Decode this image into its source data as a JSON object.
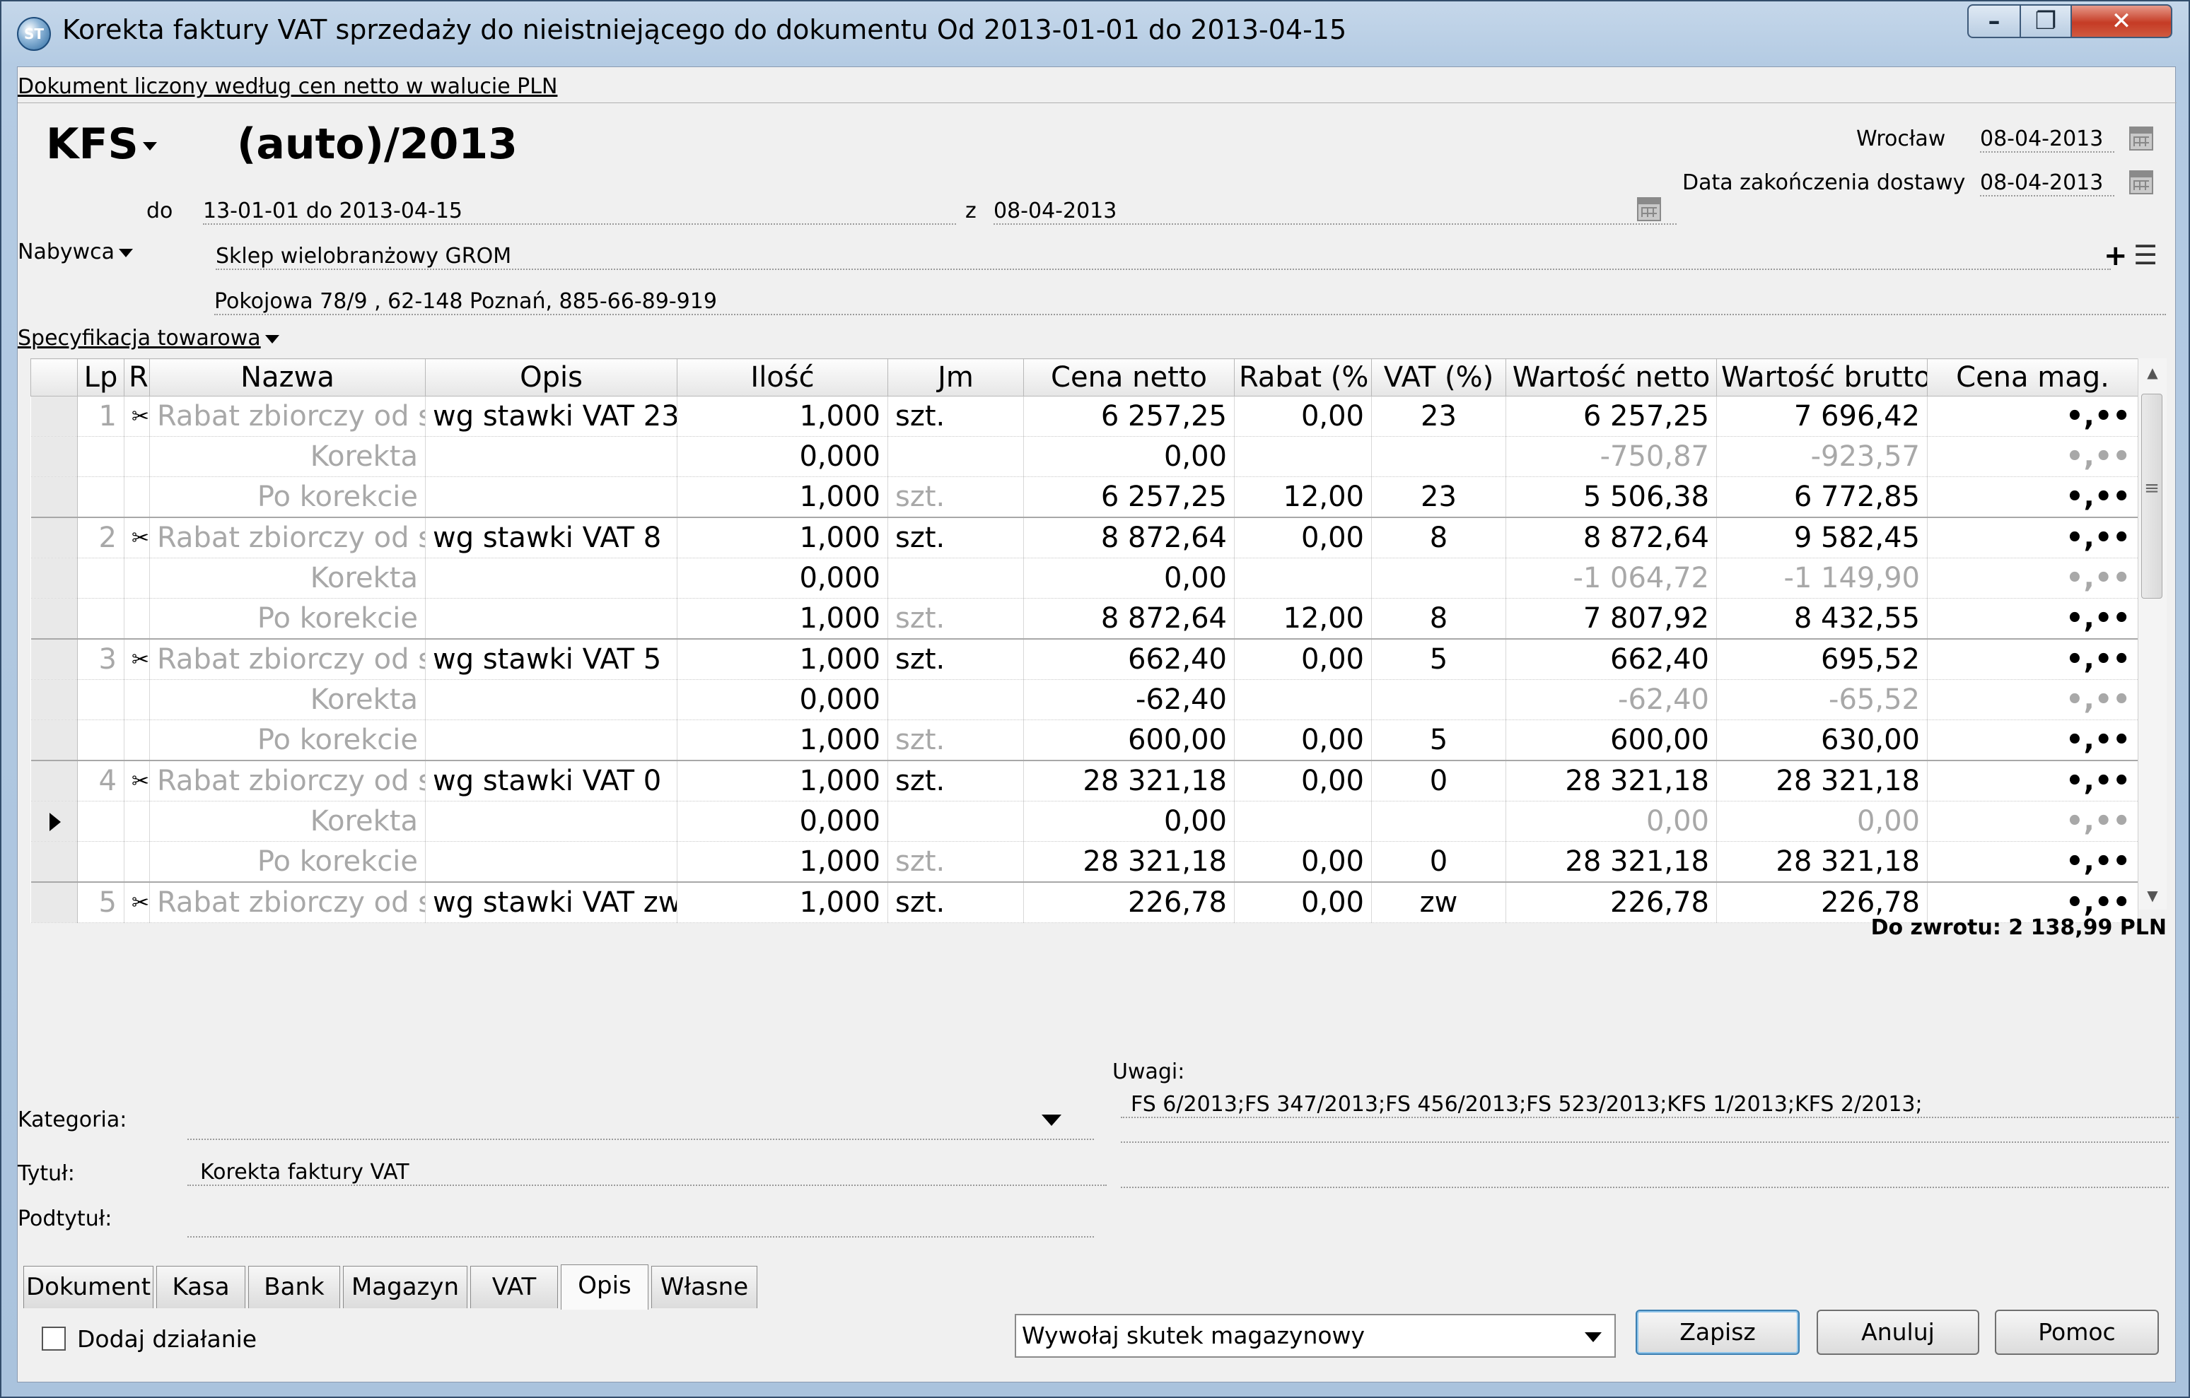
{
  "window": {
    "title": "Korekta faktury VAT sprzedaży do nieistniejącego do dokumentu Od 2013-01-01 do 2013-04-15",
    "icon": "app-logo-icon"
  },
  "doc_link": "Dokument liczony według cen netto w walucie PLN",
  "header": {
    "doc_type": "KFS",
    "number": "(auto)/2013",
    "do_label": "do",
    "do_value": "13-01-01 do 2013-04-15",
    "z_label": "z",
    "z_value": "08-04-2013",
    "city": "Wrocław",
    "city_date": "08-04-2013",
    "delivery_label": "Data zakończenia dostawy",
    "delivery_date": "08-04-2013"
  },
  "buyer": {
    "label": "Nabywca",
    "name": "Sklep wielobranżowy GROM",
    "address": "Pokojowa  78/9 , 62-148 Poznań, 885-66-89-919",
    "add_glyph": "+"
  },
  "spec_label": "Specyfikacja towarowa",
  "table": {
    "columns": [
      "",
      "Lp",
      "R",
      "Nazwa",
      "Opis",
      "Ilość",
      "Jm",
      "Cena netto",
      "Rabat (%",
      "VAT (%)",
      "Wartość netto",
      "Wartość brutto",
      "Cena mag."
    ],
    "rows": [
      {
        "lp": "1",
        "r": "✂",
        "nazwa": "Rabat zbiorczy od s",
        "opis": "wg stawki VAT 23",
        "ilosc": "1,000",
        "jm": "szt.",
        "cena": "6 257,25",
        "rabat": "0,00",
        "vat": "23",
        "wn": "6 257,25",
        "wb": "7 696,42",
        "mag": "•,••"
      },
      {
        "lp": "",
        "r": "",
        "nazwa": "Korekta",
        "opis": "",
        "ilosc": "0,000",
        "jm": "",
        "cena": "0,00",
        "rabat": "",
        "vat": "",
        "wn": "-750,87",
        "wb": "-923,57",
        "mag": "•,••"
      },
      {
        "lp": "",
        "r": "",
        "nazwa": "Po korekcie",
        "opis": "",
        "ilosc": "1,000",
        "jm": "szt.",
        "cena": "6 257,25",
        "rabat": "12,00",
        "vat": "23",
        "wn": "5 506,38",
        "wb": "6 772,85",
        "mag": "•,••"
      },
      {
        "lp": "2",
        "r": "✂",
        "nazwa": "Rabat zbiorczy od s",
        "opis": "wg stawki VAT 8",
        "ilosc": "1,000",
        "jm": "szt.",
        "cena": "8 872,64",
        "rabat": "0,00",
        "vat": "8",
        "wn": "8 872,64",
        "wb": "9 582,45",
        "mag": "•,••"
      },
      {
        "lp": "",
        "r": "",
        "nazwa": "Korekta",
        "opis": "",
        "ilosc": "0,000",
        "jm": "",
        "cena": "0,00",
        "rabat": "",
        "vat": "",
        "wn": "-1 064,72",
        "wb": "-1 149,90",
        "mag": "•,••"
      },
      {
        "lp": "",
        "r": "",
        "nazwa": "Po korekcie",
        "opis": "",
        "ilosc": "1,000",
        "jm": "szt.",
        "cena": "8 872,64",
        "rabat": "12,00",
        "vat": "8",
        "wn": "7 807,92",
        "wb": "8 432,55",
        "mag": "•,••"
      },
      {
        "lp": "3",
        "r": "✂",
        "nazwa": "Rabat zbiorczy od s",
        "opis": "wg stawki VAT 5",
        "ilosc": "1,000",
        "jm": "szt.",
        "cena": "662,40",
        "rabat": "0,00",
        "vat": "5",
        "wn": "662,40",
        "wb": "695,52",
        "mag": "•,••"
      },
      {
        "lp": "",
        "r": "",
        "nazwa": "Korekta",
        "opis": "",
        "ilosc": "0,000",
        "jm": "",
        "cena": "-62,40",
        "rabat": "",
        "vat": "",
        "wn": "-62,40",
        "wb": "-65,52",
        "mag": "•,••"
      },
      {
        "lp": "",
        "r": "",
        "nazwa": "Po korekcie",
        "opis": "",
        "ilosc": "1,000",
        "jm": "szt.",
        "cena": "600,00",
        "rabat": "0,00",
        "vat": "5",
        "wn": "600,00",
        "wb": "630,00",
        "mag": "•,••"
      },
      {
        "lp": "4",
        "r": "✂",
        "nazwa": "Rabat zbiorczy od s",
        "opis": "wg stawki VAT 0",
        "ilosc": "1,000",
        "jm": "szt.",
        "cena": "28 321,18",
        "rabat": "0,00",
        "vat": "0",
        "wn": "28 321,18",
        "wb": "28 321,18",
        "mag": "•,••"
      },
      {
        "lp": "",
        "r": "",
        "nazwa": "Korekta",
        "opis": "",
        "ilosc": "0,000",
        "jm": "",
        "cena": "0,00",
        "rabat": "",
        "vat": "",
        "wn": "0,00",
        "wb": "0,00",
        "mag": "•,••",
        "current": true
      },
      {
        "lp": "",
        "r": "",
        "nazwa": "Po korekcie",
        "opis": "",
        "ilosc": "1,000",
        "jm": "szt.",
        "cena": "28 321,18",
        "rabat": "0,00",
        "vat": "0",
        "wn": "28 321,18",
        "wb": "28 321,18",
        "mag": "•,••"
      },
      {
        "lp": "5",
        "r": "✂",
        "nazwa": "Rabat zbiorczy od s",
        "opis": "wg stawki VAT zw",
        "ilosc": "1,000",
        "jm": "szt.",
        "cena": "226,78",
        "rabat": "0,00",
        "vat": "zw",
        "wn": "226,78",
        "wb": "226,78",
        "mag": "•,••"
      }
    ]
  },
  "total": "Do zwrotu: 2 138,99 PLN",
  "form": {
    "kategoria_label": "Kategoria:",
    "kategoria_value": "",
    "tytul_label": "Tytuł:",
    "tytul_value": "Korekta faktury VAT",
    "podtytul_label": "Podtytuł:",
    "podtytul_value": "",
    "uwagi_label": "Uwagi:",
    "uwagi_value": "FS 6/2013;FS 347/2013;FS 456/2013;FS 523/2013;KFS 1/2013;KFS 2/2013;"
  },
  "tabs": [
    "Dokument",
    "Kasa",
    "Bank",
    "Magazyn",
    "VAT",
    "Opis",
    "Własne"
  ],
  "active_tab": "Opis",
  "footer": {
    "checkbox_label": "Dodaj działanie",
    "combo_value": "Wywołaj skutek magazynowy",
    "save": "Zapisz",
    "cancel": "Anuluj",
    "help": "Pomoc"
  },
  "colors": {
    "titlebar": "#b4cbe3",
    "close": "#c53b25",
    "grid_bg": "#ffffff",
    "muted_text": "#a8a8a8"
  }
}
